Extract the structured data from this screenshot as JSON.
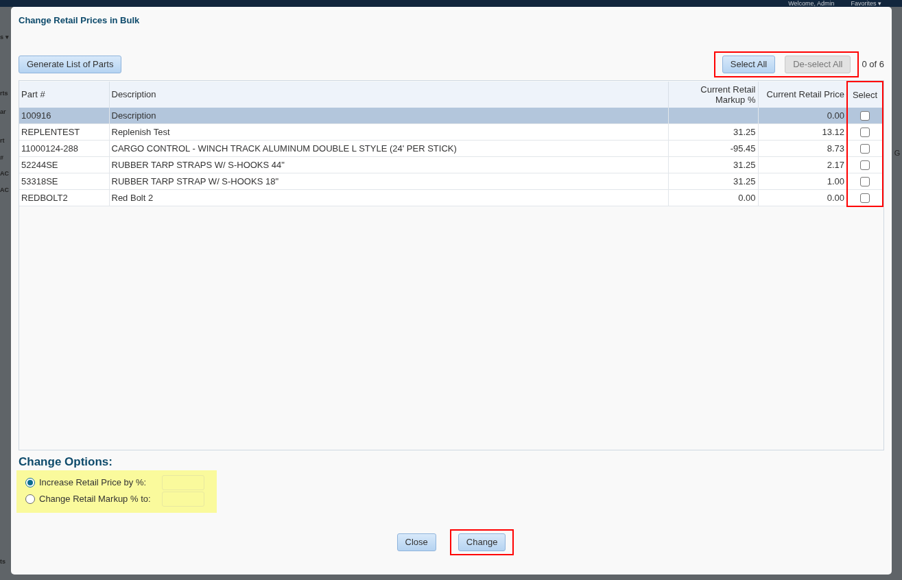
{
  "background": {
    "welcome": "Welcome, Admin",
    "favorites": "Favorites ▾",
    "left_fragments": [
      "s ▾",
      "rts",
      "ar",
      "rt",
      "#",
      "AC",
      "AC",
      "ts"
    ],
    "right_fragments": [
      "G"
    ]
  },
  "dialog": {
    "title": "Change Retail Prices in Bulk",
    "generate_button": "Generate List of Parts",
    "bulk_select": {
      "highlighted": true,
      "buttons": [
        {
          "label": "Select All",
          "disabled": false
        },
        {
          "label": "De-select All",
          "disabled": true
        }
      ]
    },
    "count": "0 of 6",
    "columns": [
      {
        "label": "Part #",
        "highlighted": false
      },
      {
        "label": "Description",
        "highlighted": false
      },
      {
        "label": "Current Retail Markup %",
        "highlighted": false
      },
      {
        "label": "Current Retail Price",
        "highlighted": false
      },
      {
        "label": "Select",
        "highlighted": true
      }
    ],
    "rows": [
      {
        "part": "100916",
        "description": "Description",
        "price": "0.00",
        "checked": false,
        "selected": true
      },
      {
        "part": "REPLENTEST",
        "description": "Replenish Test",
        "markup": "31.25",
        "price": "13.12",
        "checked": false,
        "selected": false
      },
      {
        "part": "11000124-288",
        "description": "CARGO CONTROL - WINCH TRACK ALUMINUM DOUBLE L STYLE (24' PER STICK)",
        "markup": "-95.45",
        "price": "8.73",
        "checked": false,
        "selected": false
      },
      {
        "part": "52244SE",
        "description": "RUBBER TARP STRAPS W/ S-HOOKS 44\"",
        "markup": "31.25",
        "price": "2.17",
        "checked": false,
        "selected": false
      },
      {
        "part": "53318SE",
        "description": "RUBBER TARP STRAP W/ S-HOOKS 18\"",
        "markup": "31.25",
        "price": "1.00",
        "checked": false,
        "selected": false
      },
      {
        "part": "REDBOLT2",
        "description": "Red Bolt 2",
        "markup": "0.00",
        "price": "0.00",
        "checked": false,
        "selected": false
      }
    ],
    "options_title": "Change Options:",
    "options": [
      {
        "label": "Increase Retail Price by %:",
        "selected": true
      },
      {
        "label": "Change Retail Markup % to:",
        "selected": false
      }
    ],
    "buttons": [
      {
        "label": "Close",
        "highlighted": false
      },
      {
        "label": "Change",
        "highlighted": true
      }
    ]
  }
}
